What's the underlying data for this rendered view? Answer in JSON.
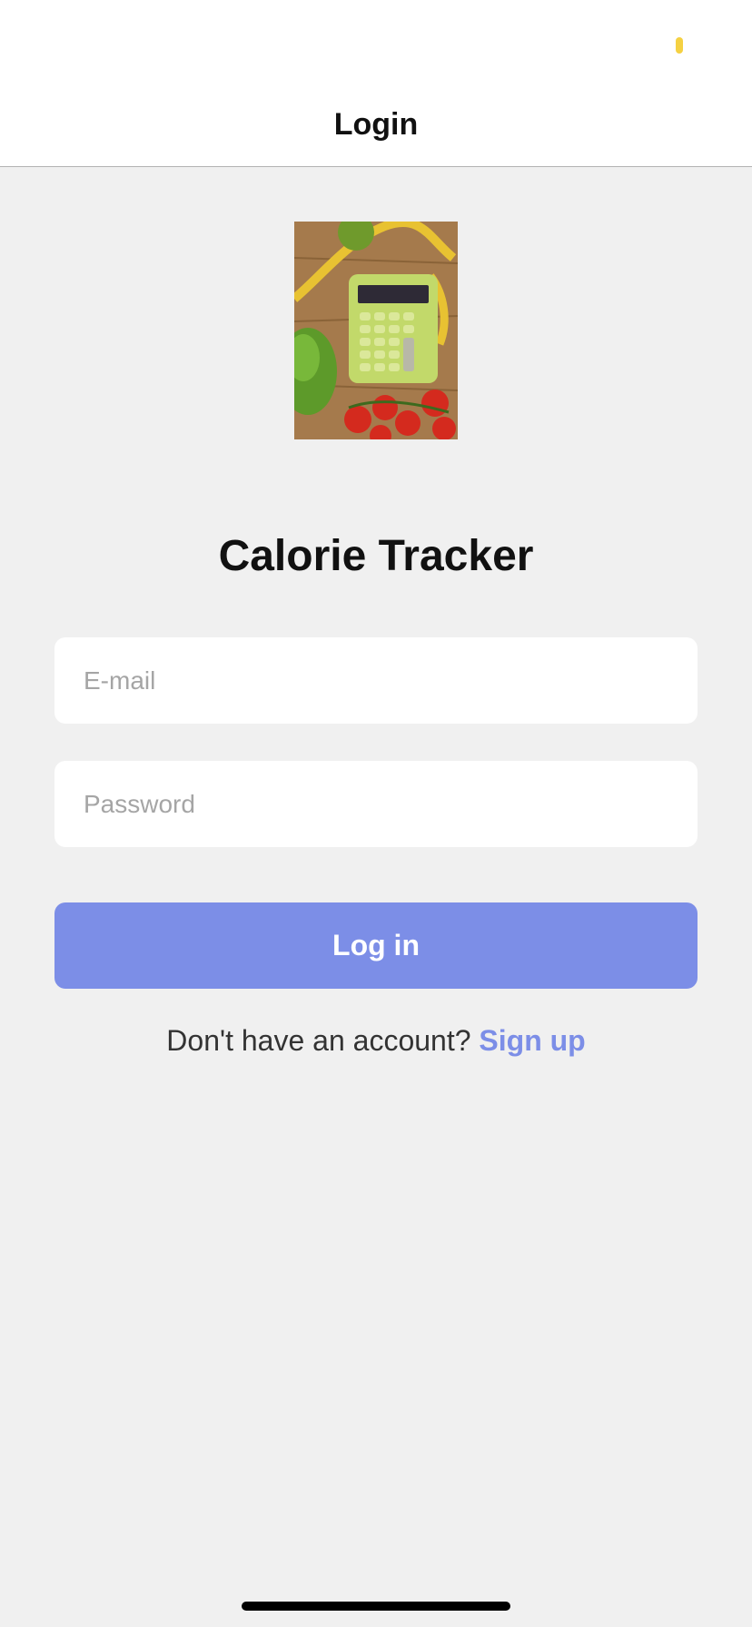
{
  "nav": {
    "title": "Login"
  },
  "hero": {
    "image": "calorie-calculator-food-photo"
  },
  "app": {
    "title": "Calorie Tracker"
  },
  "form": {
    "email_placeholder": "E-mail",
    "password_placeholder": "Password",
    "login_label": "Log in"
  },
  "signup": {
    "prompt": "Don't have an account?",
    "link_label": "Sign up"
  },
  "colors": {
    "accent": "#7c8ee7",
    "background": "#f0f0f0",
    "status_dot": "#f5d142"
  }
}
